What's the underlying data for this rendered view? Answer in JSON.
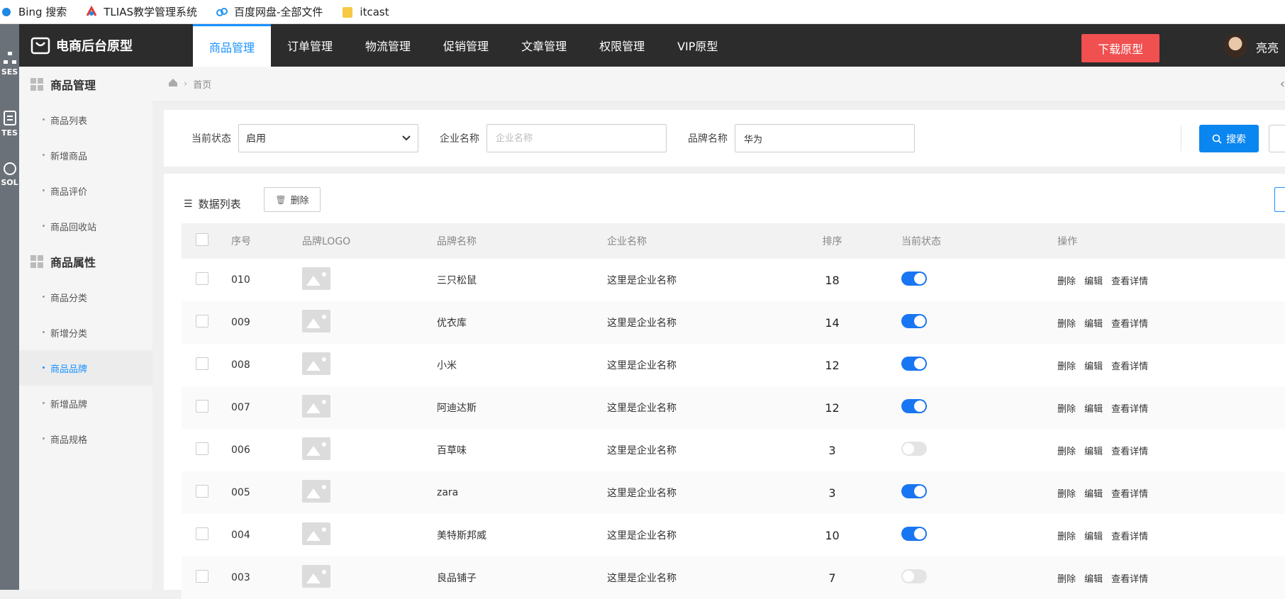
{
  "bookmarks": [
    {
      "label": "Bing 搜索",
      "icon": "bing-icon"
    },
    {
      "label": "TLIAS教学管理系统",
      "icon": "tlias-icon"
    },
    {
      "label": "百度网盘-全部文件",
      "icon": "baidu-cloud-icon"
    },
    {
      "label": "itcast",
      "icon": "folder-icon"
    }
  ],
  "left_strip": {
    "labels": [
      "SES",
      "TES",
      "SOL"
    ]
  },
  "topnav": {
    "app_title": "电商后台原型",
    "tabs": [
      "商品管理",
      "订单管理",
      "物流管理",
      "促销管理",
      "文章管理",
      "权限管理",
      "VIP原型"
    ],
    "active_tab": "商品管理",
    "download_label": "下载原型",
    "username": "亮亮"
  },
  "sidebar": {
    "group1": {
      "title": "商品管理",
      "items": [
        "商品列表",
        "新增商品",
        "商品评价",
        "商品回收站"
      ]
    },
    "group2": {
      "title": "商品属性",
      "items": [
        "商品分类",
        "新增分类",
        "商品品牌",
        "新增品牌",
        "商品规格"
      ]
    },
    "active_item": "商品品牌"
  },
  "breadcrumb": {
    "home": "首页"
  },
  "filter": {
    "status_label": "当前状态",
    "status_value": "启用",
    "company_label": "企业名称",
    "company_placeholder": "企业名称",
    "brand_label": "品牌名称",
    "brand_value": "华为",
    "search_label": "搜索"
  },
  "panel": {
    "title": "数据列表",
    "delete_label": "删除"
  },
  "table": {
    "columns": [
      "序号",
      "品牌LOGO",
      "品牌名称",
      "企业名称",
      "排序",
      "当前状态",
      "操作"
    ],
    "actions": [
      "删除",
      "编辑",
      "查看详情"
    ],
    "rows": [
      {
        "id": "010",
        "brand": "三只松鼠",
        "company": "这里是企业名称",
        "sort": "18",
        "enabled": true
      },
      {
        "id": "009",
        "brand": "优衣库",
        "company": "这里是企业名称",
        "sort": "14",
        "enabled": true
      },
      {
        "id": "008",
        "brand": "小米",
        "company": "这里是企业名称",
        "sort": "12",
        "enabled": true
      },
      {
        "id": "007",
        "brand": "阿迪达斯",
        "company": "这里是企业名称",
        "sort": "12",
        "enabled": true
      },
      {
        "id": "006",
        "brand": "百草味",
        "company": "这里是企业名称",
        "sort": "3",
        "enabled": false
      },
      {
        "id": "005",
        "brand": "zara",
        "company": "这里是企业名称",
        "sort": "3",
        "enabled": true
      },
      {
        "id": "004",
        "brand": "美特斯邦威",
        "company": "这里是企业名称",
        "sort": "10",
        "enabled": true
      },
      {
        "id": "003",
        "brand": "良品铺子",
        "company": "这里是企业名称",
        "sort": "7",
        "enabled": false
      }
    ]
  },
  "colors": {
    "accent": "#1890ff",
    "download": "#f05050",
    "nav_bg": "#2c2c2c",
    "toggle_on": "#1976f2"
  }
}
